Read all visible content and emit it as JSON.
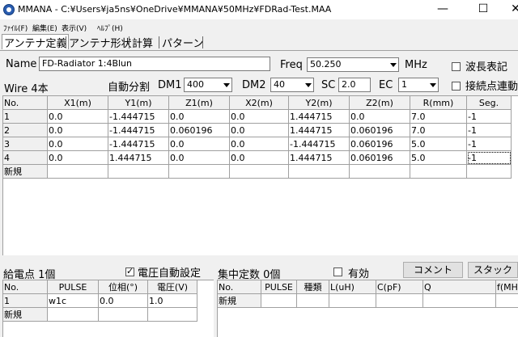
{
  "window": {
    "title": "MMANA - C:¥Users¥ja5ns¥OneDrive¥MMANA¥50MHz¥FDRad-Test.MAA",
    "minimize": "—",
    "maximize": "☐",
    "close": "✕"
  },
  "menu": [
    "ﾌｧｲﾙ(F)",
    "編集(E)",
    "表示(V)",
    "ﾍﾙﾌﾟ(H)"
  ],
  "tabs": [
    "アンテナ定義",
    "アンテナ形状",
    "計算",
    "パターン"
  ],
  "form": {
    "name_label": "Name",
    "name_value": "FD-Radiator 1:4Blun",
    "freq_label": "Freq",
    "freq_value": "50.250",
    "mhz_label": "MHz",
    "wave_label": "波長表記",
    "wire_label": "Wire 4本",
    "autodiv_label": "自動分割",
    "dm1_label": "DM1",
    "dm1_value": "400",
    "dm2_label": "DM2",
    "dm2_value": "40",
    "sc_label": "SC",
    "sc_value": "2.0",
    "ec_label": "EC",
    "ec_value": "1",
    "conn_label": "接続点連動"
  },
  "wire_table": {
    "headers": [
      "No.",
      "X1(m)",
      "Y1(m)",
      "Z1(m)",
      "X2(m)",
      "Y2(m)",
      "Z2(m)",
      "R(mm)",
      "Seg."
    ],
    "rows": [
      [
        "1",
        "0.0",
        "-1.444715",
        "0.0",
        "0.0",
        "1.444715",
        "0.0",
        "7.0",
        "-1"
      ],
      [
        "2",
        "0.0",
        "-1.444715",
        "0.060196",
        "0.0",
        "1.444715",
        "0.060196",
        "7.0",
        "-1"
      ],
      [
        "3",
        "0.0",
        "-1.444715",
        "0.0",
        "0.0",
        "-1.444715",
        "0.060196",
        "5.0",
        "-1"
      ],
      [
        "4",
        "0.0",
        "1.444715",
        "0.0",
        "0.0",
        "1.444715",
        "0.060196",
        "5.0",
        "-1"
      ]
    ],
    "new_row": "新規"
  },
  "source": {
    "label": "給電点 1個",
    "auto_label": "電圧自動設定",
    "auto_checked": true,
    "headers": [
      "No.",
      "PULSE",
      "位相(°)",
      "電圧(V)"
    ],
    "rows": [
      [
        "1",
        "w1c",
        "0.0",
        "1.0"
      ]
    ],
    "new_row": "新規"
  },
  "load": {
    "label": "集中定数 0個",
    "valid_label": "有効",
    "valid_checked": false,
    "comment_button": "コメント",
    "stack_button": "スタック",
    "headers": [
      "No.",
      "PULSE",
      "種類",
      "L(uH)",
      "C(pF)",
      "Q",
      "f(MHz)"
    ],
    "new_row": "新規"
  }
}
